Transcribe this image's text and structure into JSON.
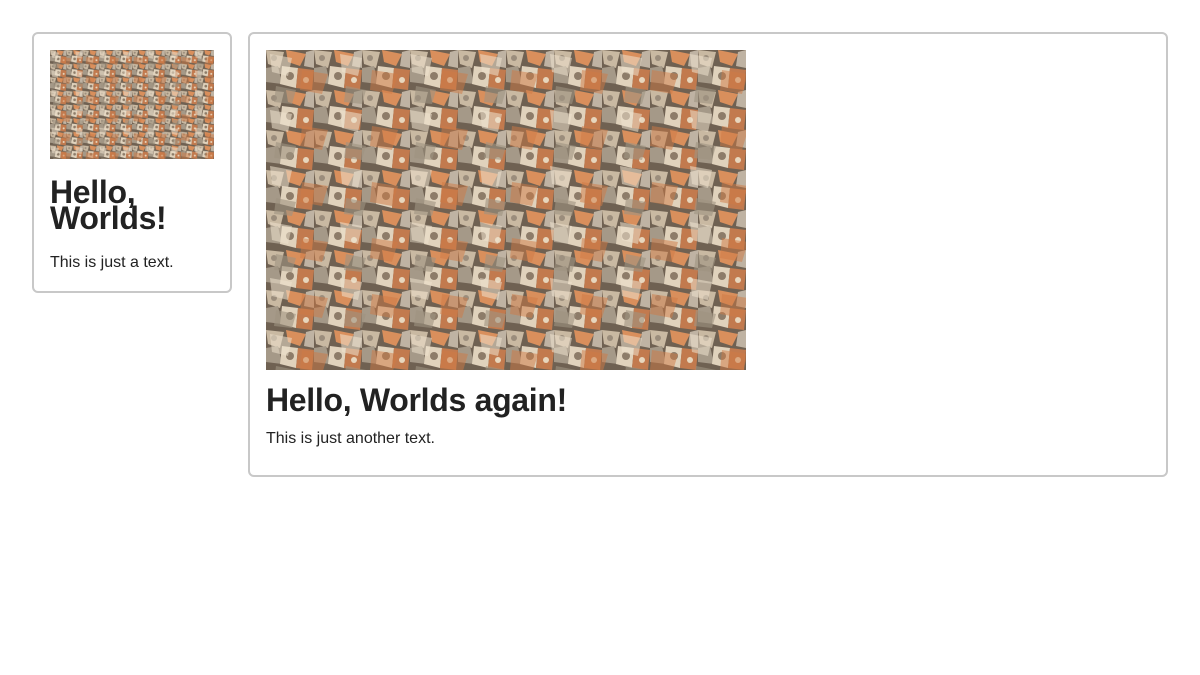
{
  "cards": [
    {
      "image": "woodpile-image",
      "title": "Hello, Worlds!",
      "text": "This is just a text."
    },
    {
      "image": "woodpile-image",
      "title": "Hello, Worlds again!",
      "text": "This is just another text."
    }
  ]
}
